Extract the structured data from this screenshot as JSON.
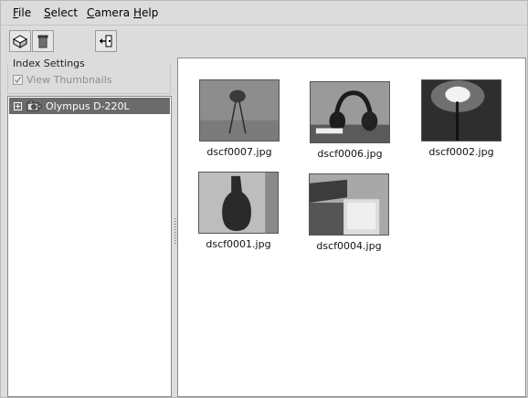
{
  "menubar": {
    "items": [
      {
        "underline": "F",
        "rest": "ile"
      },
      {
        "underline": "S",
        "rest": "elect"
      },
      {
        "underline": "C",
        "rest": "amera"
      },
      {
        "underline": "H",
        "rest": "elp"
      }
    ]
  },
  "toolbar": {
    "buttons": [
      "save-icon",
      "trash-icon",
      "exit-icon"
    ]
  },
  "left_panel": {
    "section_label": "Index Settings",
    "view_thumbnails": {
      "label": "View Thumbnails",
      "checked": true,
      "enabled": false
    },
    "tree": [
      {
        "label": "Olympus D-220L",
        "icon": "camera-icon",
        "selected": true
      }
    ]
  },
  "gallery": {
    "items": [
      {
        "filename": "dscf0007.jpg"
      },
      {
        "filename": "dscf0006.jpg"
      },
      {
        "filename": "dscf0002.jpg"
      },
      {
        "filename": "dscf0001.jpg"
      },
      {
        "filename": "dscf0004.jpg"
      }
    ]
  },
  "colors": {
    "window_bg": "#dcdcdc",
    "selection_bg": "#6b6b6b",
    "panel_bg": "#ffffff"
  }
}
